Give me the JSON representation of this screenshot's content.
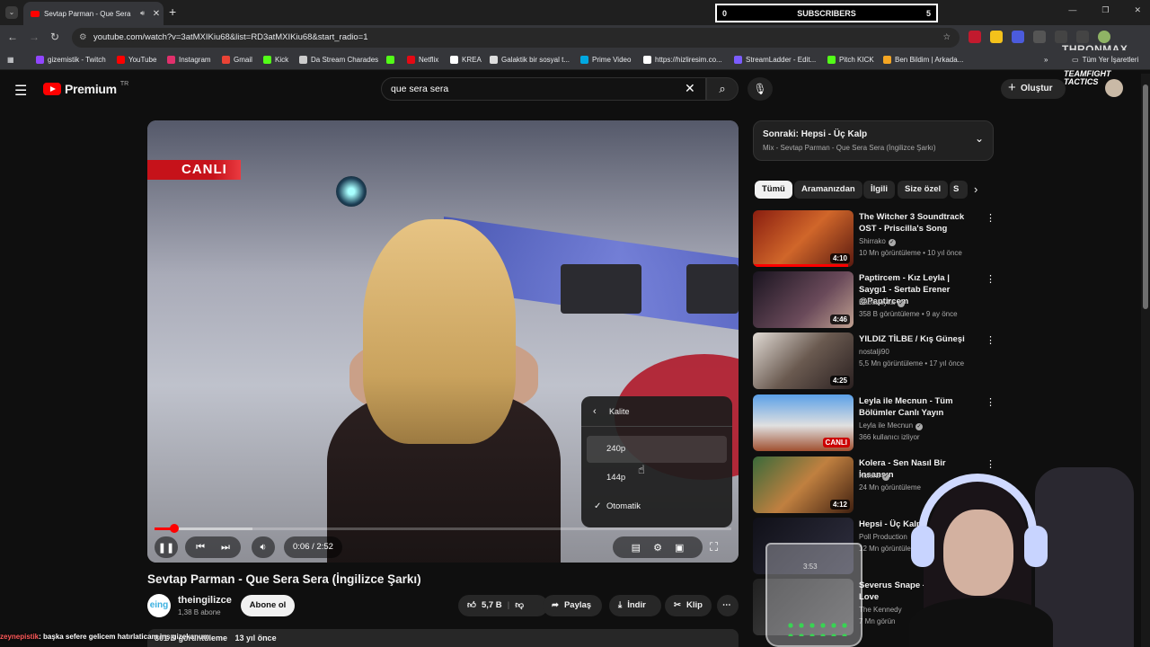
{
  "browser": {
    "tab_title": "Sevtap Parman - Que Sera",
    "tab_close": "✕",
    "new_tab": "+",
    "url": "youtube.com/watch?v=3atMXIKiu68&list=RD3atMXIKiu68&start_radio=1",
    "bookmarks": [
      {
        "label": "gizemistik - Twitch",
        "color": "#9146ff"
      },
      {
        "label": "YouTube",
        "color": "#ff0000"
      },
      {
        "label": "Instagram",
        "color": "#e1306c"
      },
      {
        "label": "Gmail",
        "color": "#ea4335"
      },
      {
        "label": "Kick",
        "color": "#53fc18"
      },
      {
        "label": "Da Stream Charades",
        "color": "#cccccc"
      },
      {
        "label": "",
        "color": "#53fc18"
      },
      {
        "label": "Netflix",
        "color": "#e50914"
      },
      {
        "label": "KREA",
        "color": "#ffffff"
      },
      {
        "label": "Galaktik bir sosyal t...",
        "color": "#dddddd"
      },
      {
        "label": "Prime Video",
        "color": "#00a8e1"
      },
      {
        "label": "https://hizliresim.co...",
        "color": "#ffffff"
      },
      {
        "label": "StreamLadder - Edit...",
        "color": "#7b5cff"
      },
      {
        "label": "Pitch KICK",
        "color": "#53fc18"
      },
      {
        "label": "Ben Bildim | Arkada...",
        "color": "#f5a623"
      }
    ],
    "all_bookmarks": "Tüm Yer İşaretleri",
    "overlay_brand": "THRONMAX"
  },
  "stream_overlay": {
    "subs_count_left": "0",
    "subs_label": "SUBSCRIBERS",
    "subs_count_right": "5",
    "tft_line1": "TEAMFIGHT",
    "tft_line2": "TACTICS",
    "chat_user": "zeynepistik",
    "chat_text": ": başka sefere gelicem hatırlaticam inş gizekanum",
    "cup_label": "3:53"
  },
  "youtube": {
    "logo_text": "Premium",
    "logo_region": "TR",
    "search_value": "que sera sera",
    "create_label": "Oluştur"
  },
  "player": {
    "live_badge": "CANLI",
    "time": "0:06 / 2:52",
    "progress": 0.035,
    "buffered": 0.17,
    "quality_menu": {
      "header": "Kalite",
      "options": [
        {
          "label": "240p",
          "selected": false,
          "hover": true
        },
        {
          "label": "144p",
          "selected": false,
          "hover": false
        },
        {
          "label": "Otomatik",
          "selected": true,
          "hover": false
        }
      ]
    }
  },
  "video": {
    "title": "Sevtap Parman - Que Sera Sera (İngilizce Şarkı)",
    "channel_avatar_text": "eing",
    "channel": "theingilizce",
    "subscribers": "1,38 B abone",
    "subscribe_label": "Abone ol",
    "likes": "5,7 B",
    "share_label": "Paylaş",
    "download_label": "İndir",
    "clip_label": "Klip",
    "views": "801 B görüntüleme",
    "age": "13 yıl önce"
  },
  "sidebar": {
    "playlist_title": "Sonraki: Hepsi - Üç Kalp",
    "playlist_sub": "Mix - Sevtap Parman - Que Sera Sera (İngilizce Şarkı)",
    "chips": [
      "Tümü",
      "Aramanızdan",
      "İlgili",
      "Size özel",
      "S"
    ],
    "recs": [
      {
        "title": "The Witcher 3 Soundtrack OST - Priscilla's Song",
        "channel": "Shirrako",
        "meta": "10 Mn görüntüleme • 10 yıl önce",
        "duration": "4:10",
        "watched": 0.95,
        "thumb_color": "#b33a1a"
      },
      {
        "title": "Paptircem - Kız Leyla | Saygı1 - Sertab Erener @Paptircem",
        "channel": "BabaLayka",
        "meta": "358 B görüntüleme • 9 ay önce",
        "duration": "4:46",
        "watched": 0.0,
        "thumb_color": "#3a2a3a"
      },
      {
        "title": "YILDIZ TİLBE / Kış Güneşi",
        "channel": "nostalji90",
        "meta": "5,5 Mn görüntüleme • 17 yıl önce",
        "duration": "4:25",
        "watched": 0.0,
        "thumb_color": "#c0b8b0"
      },
      {
        "title": "Leyla ile Mecnun - Tüm Bölümler Canlı Yayın",
        "channel": "Leyla ile Mecnun",
        "meta": "366 kullanıcı izliyor",
        "duration": "CANLI",
        "watched": 0.0,
        "thumb_color": "#4a78c0"
      },
      {
        "title": "Kolera - Sen Nasıl Bir İnsansın",
        "channel": "Kolera",
        "meta": "24 Mn görüntüleme",
        "duration": "4:12",
        "watched": 0.0,
        "thumb_color": "#6a3a1a"
      },
      {
        "title": "Hepsi - Üç Kalp",
        "channel": "Poll Production",
        "meta": "12 Mn görüntüleme",
        "duration": "3:53",
        "watched": 0.0,
        "thumb_color": "#2a2a3a"
      },
      {
        "title": "Severus Snape - Another Love",
        "channel": "The Kennedy",
        "meta": "7 Mn görün",
        "duration": "",
        "watched": 0.0,
        "thumb_color": "#3a3a3a"
      }
    ]
  }
}
